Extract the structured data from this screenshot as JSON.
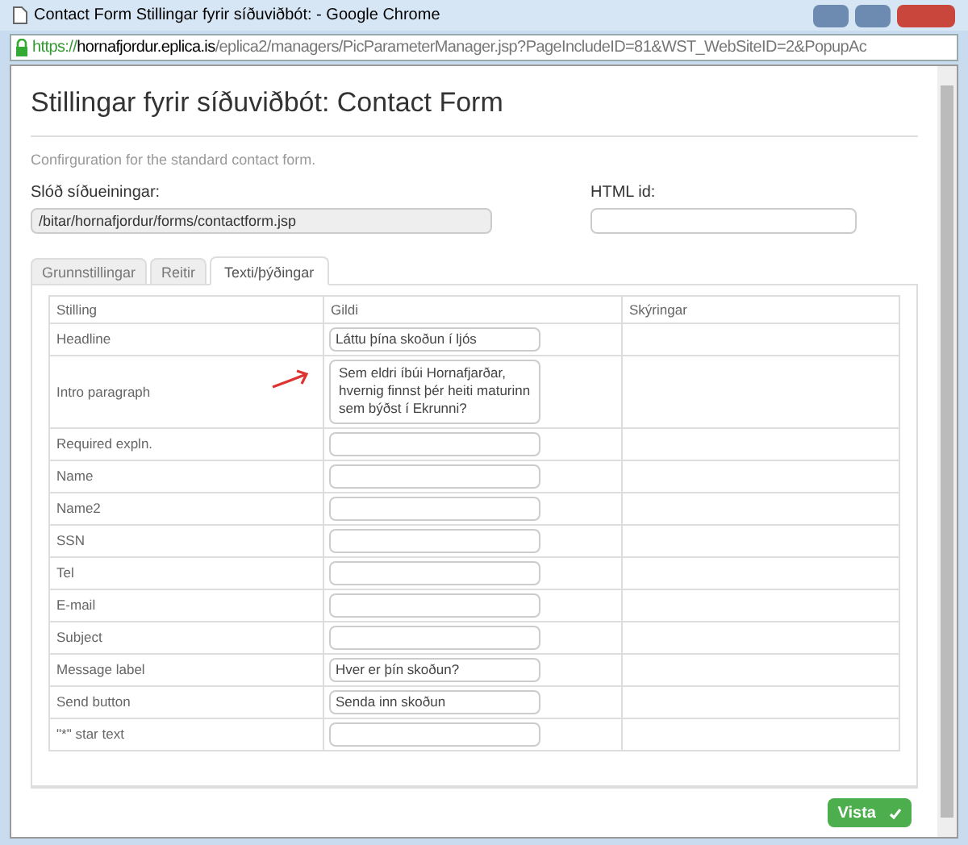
{
  "window": {
    "title": "Contact Form Stillingar fyrir síðuviðbót: - Google Chrome"
  },
  "address_bar": {
    "scheme": "https://",
    "host": "hornafjordur.eplica.is",
    "path": "/eplica2/managers/PicParameterManager.jsp?PageIncludeID=81&WST_WebSiteID=2&PopupAc"
  },
  "dialog": {
    "title": "Stillingar fyrir síðuviðbót: Contact Form",
    "description": "Confirguration for the standard contact form.",
    "path_field": {
      "label": "Slóð síðueiningar:",
      "value": "/bitar/hornafjordur/forms/contactform.jsp"
    },
    "html_id_field": {
      "label": "HTML id:"
    }
  },
  "tabs": [
    {
      "label": "Grunnstillingar",
      "selected": false
    },
    {
      "label": "Reitir",
      "selected": false
    },
    {
      "label": "Texti/þýðingar",
      "selected": true
    }
  ],
  "table": {
    "columns": [
      "Stilling",
      "Gildi",
      "Skýringar"
    ],
    "rows": [
      {
        "label": "Headline",
        "kind": "text",
        "value": "Láttu þína skoðun í ljós"
      },
      {
        "label": "Intro paragraph",
        "kind": "textarea",
        "value": "Sem eldri íbúi Hornafjarðar, hvernig finnst þér heiti maturinn sem býðst í Ekrunni?"
      },
      {
        "label": "Required expln.",
        "kind": "text"
      },
      {
        "label": "Name",
        "kind": "text"
      },
      {
        "label": "Name2",
        "kind": "text"
      },
      {
        "label": "SSN",
        "kind": "text"
      },
      {
        "label": "Tel",
        "kind": "text"
      },
      {
        "label": "E-mail",
        "kind": "text"
      },
      {
        "label": "Subject",
        "kind": "text"
      },
      {
        "label": "Message label",
        "kind": "text",
        "value": "Hver er þín skoðun?"
      },
      {
        "label": "Send button",
        "kind": "text",
        "value": "Senda inn skoðun"
      },
      {
        "label": "\"*\" star text",
        "kind": "text"
      }
    ]
  },
  "save_button": {
    "label": "Vista"
  }
}
